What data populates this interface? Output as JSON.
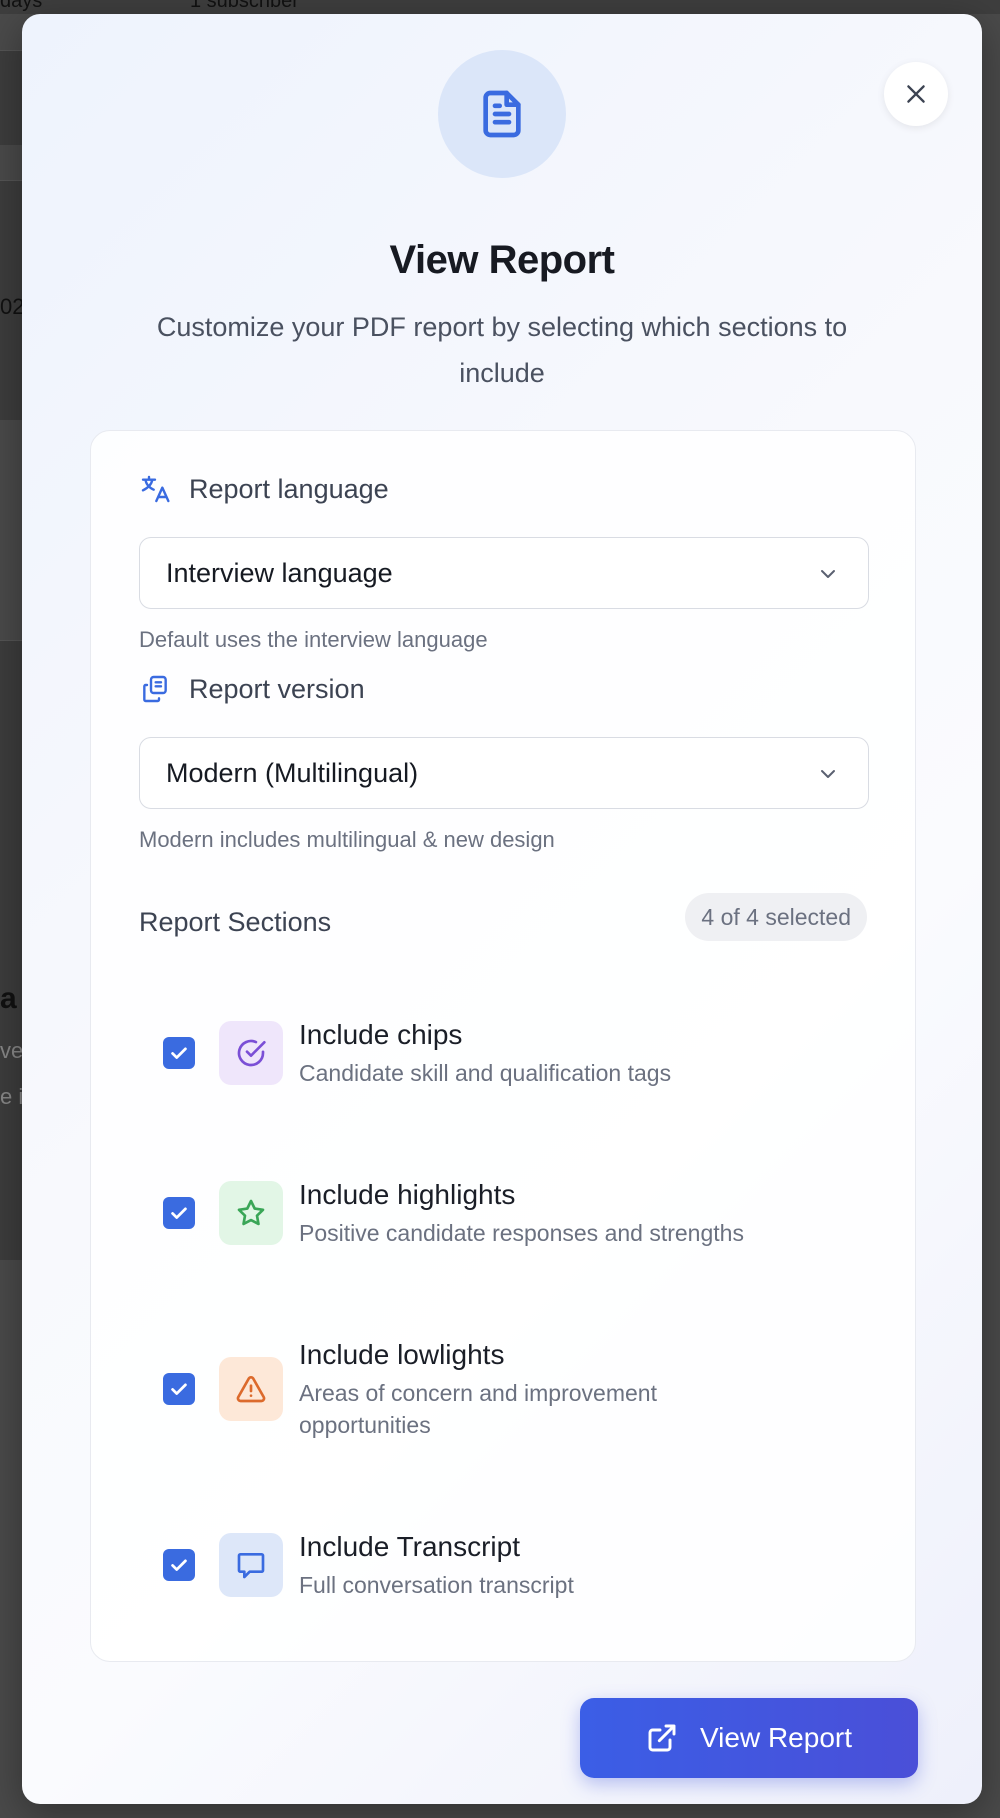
{
  "background": {
    "top_text_1": "days",
    "top_text_2": "1 subscriber",
    "side_text_1": "02",
    "side_text_2": "a",
    "side_text_3": "ve",
    "side_text_4": "e i"
  },
  "modal": {
    "title": "View Report",
    "subtitle": "Customize your PDF report by selecting which sections to include",
    "hero_icon": "document-icon",
    "close_icon": "close-icon"
  },
  "language": {
    "label": "Report language",
    "icon": "translate-icon",
    "selected": "Interview language",
    "hint": "Default uses the interview language"
  },
  "version": {
    "label": "Report version",
    "icon": "copy-icon",
    "selected": "Modern (Multilingual)",
    "hint": "Modern includes multilingual & new design"
  },
  "sections": {
    "title": "Report Sections",
    "count": "4 of 4 selected",
    "items": [
      {
        "title": "Include chips",
        "desc": "Candidate skill and qualification tags",
        "icon": "check-circle-icon",
        "checked": true,
        "color": "#7b4fd6",
        "bg": "#efe6fb"
      },
      {
        "title": "Include highlights",
        "desc": "Positive candidate responses and strengths",
        "icon": "star-icon",
        "checked": true,
        "color": "#3aa657",
        "bg": "#e2f6e6"
      },
      {
        "title": "Include lowlights",
        "desc": "Areas of concern and improvement opportunities",
        "icon": "warning-icon",
        "checked": true,
        "color": "#dc6a2c",
        "bg": "#fde8d8"
      },
      {
        "title": "Include Transcript",
        "desc": "Full conversation transcript",
        "icon": "chat-icon",
        "checked": true,
        "color": "#3a6be0",
        "bg": "#dde7f9"
      }
    ]
  },
  "action": {
    "label": "View Report",
    "icon": "external-link-icon"
  },
  "colors": {
    "accent": "#3a6be0",
    "button_start": "#3b5ee6",
    "button_end": "#4a4fd8"
  }
}
